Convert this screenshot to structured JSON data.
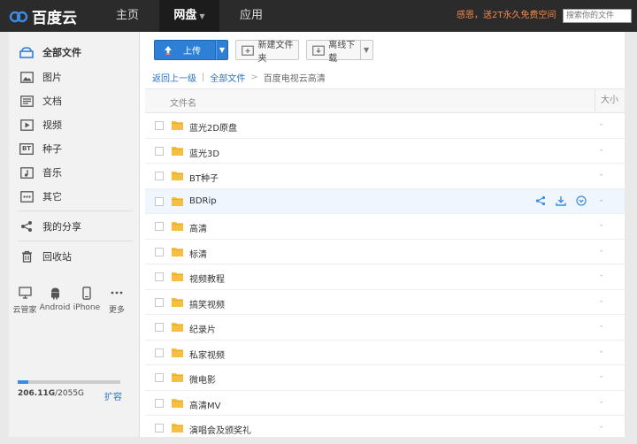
{
  "app": {
    "brand": "百度云"
  },
  "nav": {
    "home": "主页",
    "disk": "网盘",
    "apps": "应用"
  },
  "promo": "感恩，送2T永久免费空间",
  "search": {
    "placeholder": "搜索你的文件"
  },
  "sidebar": {
    "items": [
      {
        "label": "全部文件",
        "icon": "cloud-folder-icon"
      },
      {
        "label": "图片",
        "icon": "image-icon"
      },
      {
        "label": "文档",
        "icon": "document-icon"
      },
      {
        "label": "视频",
        "icon": "video-icon"
      },
      {
        "label": "种子",
        "icon": "bt-icon",
        "badge": "BT"
      },
      {
        "label": "音乐",
        "icon": "music-icon"
      },
      {
        "label": "其它",
        "icon": "more-icon"
      },
      {
        "label": "我的分享",
        "icon": "share-icon"
      },
      {
        "label": "回收站",
        "icon": "trash-icon"
      }
    ],
    "devices": [
      {
        "label": "云管家",
        "icon": "monitor-icon"
      },
      {
        "label": "Android",
        "icon": "android-icon"
      },
      {
        "label": "iPhone",
        "icon": "iphone-icon"
      },
      {
        "label": "更多",
        "icon": "ellipsis-icon"
      }
    ],
    "quota": {
      "used": "206.11G",
      "total": "/2055G",
      "used_fraction": 0.1,
      "expand": "扩容"
    }
  },
  "toolbar": {
    "upload": "上传",
    "new_folder": "新建文件夹",
    "offline": "离线下载"
  },
  "breadcrumb": {
    "back": "返回上一级",
    "all": "全部文件",
    "separator": ">",
    "current": "百度电视云高清"
  },
  "list": {
    "columns": {
      "name": "文件名",
      "size": "大小"
    },
    "rows": [
      {
        "name": "蓝光2D原盘",
        "size": "-"
      },
      {
        "name": "蓝光3D",
        "size": "-"
      },
      {
        "name": "BT种子",
        "size": "-"
      },
      {
        "name": "BDRip",
        "size": "-",
        "hover": true
      },
      {
        "name": "高清",
        "size": "-"
      },
      {
        "name": "标清",
        "size": "-"
      },
      {
        "name": "视频教程",
        "size": "-"
      },
      {
        "name": "搞笑视频",
        "size": "-"
      },
      {
        "name": "纪录片",
        "size": "-"
      },
      {
        "name": "私家视频",
        "size": "-"
      },
      {
        "name": "微电影",
        "size": "-"
      },
      {
        "name": "高清MV",
        "size": "-"
      },
      {
        "name": "演唱会及颁奖礼",
        "size": "-"
      }
    ]
  },
  "colors": {
    "accent": "#2e80d6",
    "topbar": "#2b2b2b",
    "promo": "#f1884a",
    "folder": "#f5c042",
    "link": "#2a73c2"
  }
}
